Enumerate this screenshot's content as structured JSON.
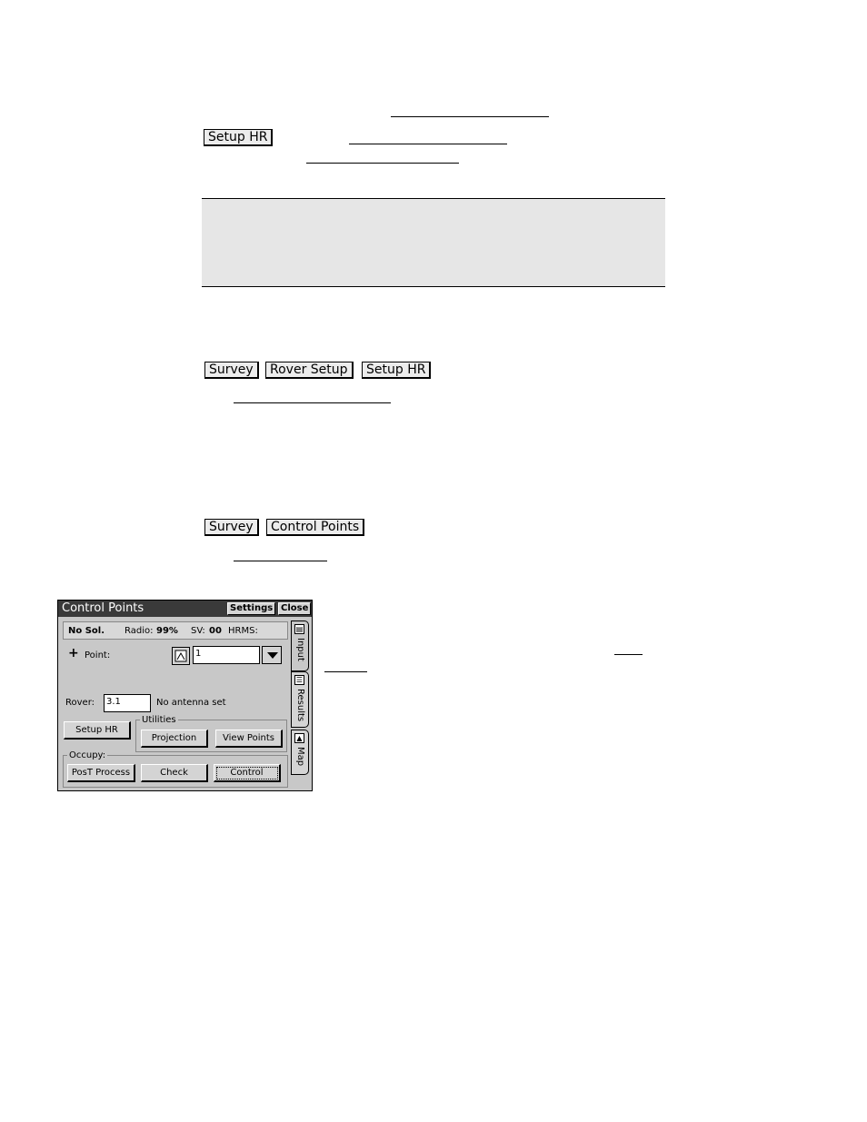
{
  "top_buttons": {
    "setup_hr": "Setup HR"
  },
  "nav1": {
    "btn1": "Survey",
    "btn2": "Rover Setup",
    "btn3": "Setup HR"
  },
  "nav2": {
    "btn1": "Survey",
    "btn2": "Control Points"
  },
  "device": {
    "title": "Control Points",
    "settings_label": "Settings",
    "close_label": "Close",
    "status": {
      "solution": "No Sol.",
      "radio_label": "Radio:",
      "radio_value": "99%",
      "sv_label": "SV:",
      "sv_value": "00",
      "hrms_label": "HRMS:"
    },
    "point_label": "Point:",
    "point_value": "1",
    "rover_label": "Rover:",
    "rover_value": "3.1",
    "antenna_text": "No antenna set",
    "setup_hr_label": "Setup HR",
    "utilities_label": "Utilities",
    "projection_label": "Projection",
    "view_points_label": "View Points",
    "occupy_label": "Occupy:",
    "post_process_label": "PosT Process",
    "check_label": "Check",
    "control_label": "Control",
    "tabs": {
      "input": "Input",
      "results": "Results",
      "map": "Map"
    }
  }
}
